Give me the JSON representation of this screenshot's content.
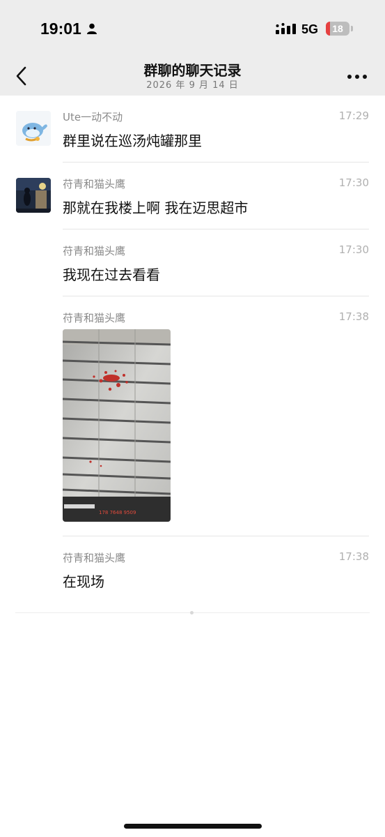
{
  "status_bar": {
    "time": "19:01",
    "network": "5G",
    "battery": "18",
    "battery_level": 0.18
  },
  "header": {
    "title": "群聊的聊天记录",
    "subtitle": "2026 年 9 月 14 日"
  },
  "messages": [
    {
      "sender": "Ute一动不动",
      "time": "17:29",
      "text": "群里说在巡汤炖罐那里",
      "avatar": "cartoon-whale"
    },
    {
      "sender": "苻青和猫头鹰",
      "time": "17:30",
      "text": "那就在我楼上啊 我在迈思超市",
      "avatar": "night-photo"
    },
    {
      "sender": "苻青和猫头鹰",
      "time": "17:30",
      "text": "我现在过去看看"
    },
    {
      "sender": "苻青和猫头鹰",
      "time": "17:38",
      "image": "photo-of-shutter-with-red-stains",
      "image_caption": "178 7648 9509"
    },
    {
      "sender": "苻青和猫头鹰",
      "time": "17:38",
      "text": "在现场"
    }
  ],
  "colors": {
    "header_bg": "#ededed",
    "name": "#8a8a8a",
    "time": "#b0b0b0",
    "battery_low": "#e64040"
  }
}
